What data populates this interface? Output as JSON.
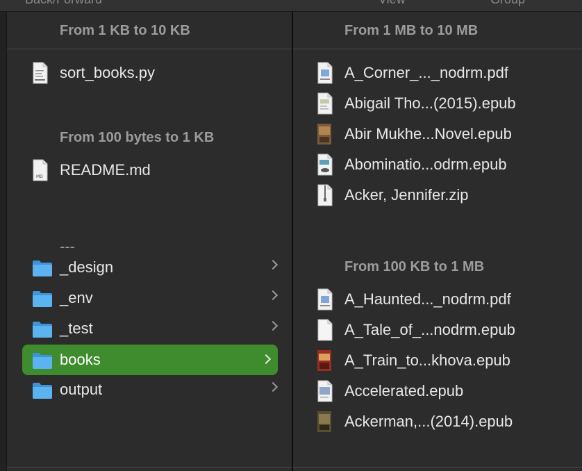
{
  "toolbar": {
    "back_forward": "Back/Forward",
    "view": "View",
    "group": "Group"
  },
  "left": {
    "group1": {
      "header": "From 1 KB to 10 KB",
      "items": [
        {
          "name": "sort_books.py",
          "icon": "python-file-icon"
        }
      ]
    },
    "group2": {
      "header": "From 100 bytes to 1 KB",
      "items": [
        {
          "name": "README.md",
          "icon": "markdown-file-icon"
        }
      ]
    },
    "separator": "---",
    "folders": [
      {
        "name": "_design",
        "icon": "folder-icon"
      },
      {
        "name": "_env",
        "icon": "folder-icon"
      },
      {
        "name": "_test",
        "icon": "folder-icon"
      },
      {
        "name": "books",
        "icon": "folder-icon",
        "selected": true
      },
      {
        "name": "output",
        "icon": "folder-icon"
      }
    ]
  },
  "right": {
    "group1": {
      "header": "From 1 MB to 10 MB",
      "items": [
        {
          "name": "A_Corner_..._nodrm.pdf",
          "icon": "pdf-file-icon"
        },
        {
          "name": "Abigail Tho...(2015).epub",
          "icon": "epub-file-icon"
        },
        {
          "name": "Abir Mukhe...Novel.epub",
          "icon": "epub-cover-icon"
        },
        {
          "name": "Abominatio...odrm.epub",
          "icon": "epub-file-icon"
        },
        {
          "name": "Acker, Jennifer.zip",
          "icon": "zip-file-icon"
        }
      ]
    },
    "group2": {
      "header": "From 100 KB to 1 MB",
      "items": [
        {
          "name": "A_Haunted..._nodrm.pdf",
          "icon": "pdf-file-icon"
        },
        {
          "name": "A_Tale_of_...nodrm.epub",
          "icon": "blank-file-icon"
        },
        {
          "name": "A_Train_to...khova.epub",
          "icon": "epub-cover-icon"
        },
        {
          "name": "Accelerated.epub",
          "icon": "epub-file-icon"
        },
        {
          "name": "Ackerman,...(2014).epub",
          "icon": "epub-cover-icon"
        }
      ]
    }
  },
  "colors": {
    "selection": "#3e8c2e",
    "folder": "#4aa6e8",
    "background": "#2c2c2c"
  }
}
